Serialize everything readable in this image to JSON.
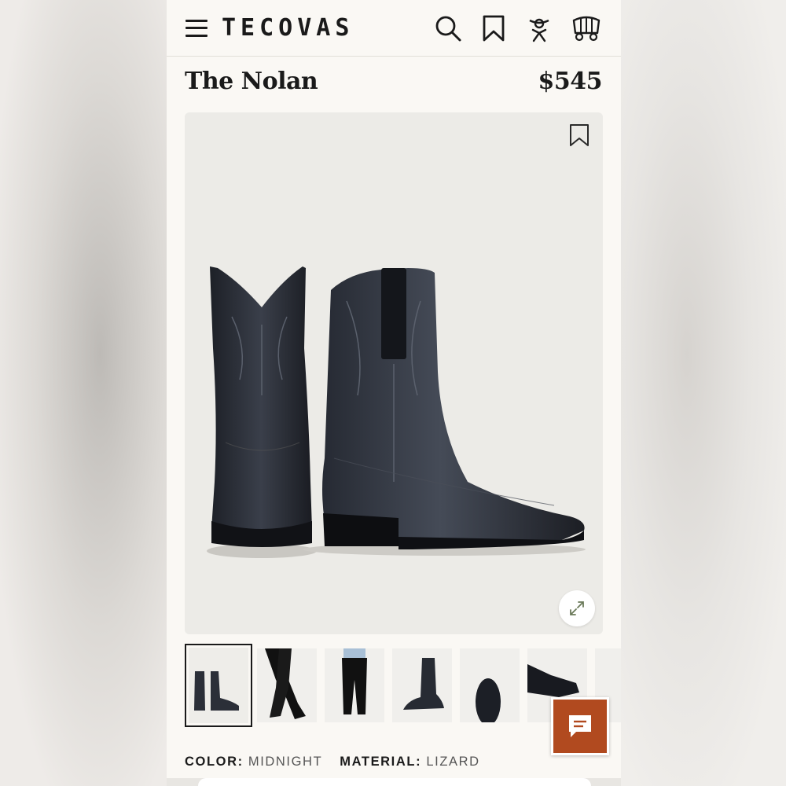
{
  "header": {
    "brand": "TECOVAS",
    "icons": [
      "menu-icon",
      "search-icon",
      "bookmark-icon",
      "account-icon",
      "wagon-cart-icon"
    ]
  },
  "product": {
    "name": "The Nolan",
    "price": "$545"
  },
  "gallery": {
    "thumbnail_count_visible": 7,
    "selected_index": 0
  },
  "attributes": {
    "color_label": "COLOR:",
    "color_value": "MIDNIGHT",
    "material_label": "MATERIAL:",
    "material_value": "LIZARD"
  },
  "colors": {
    "background": "#faf8f4",
    "image_bg": "#ecebe7",
    "chat_button": "#b14a1f",
    "text": "#1a1a1a"
  }
}
